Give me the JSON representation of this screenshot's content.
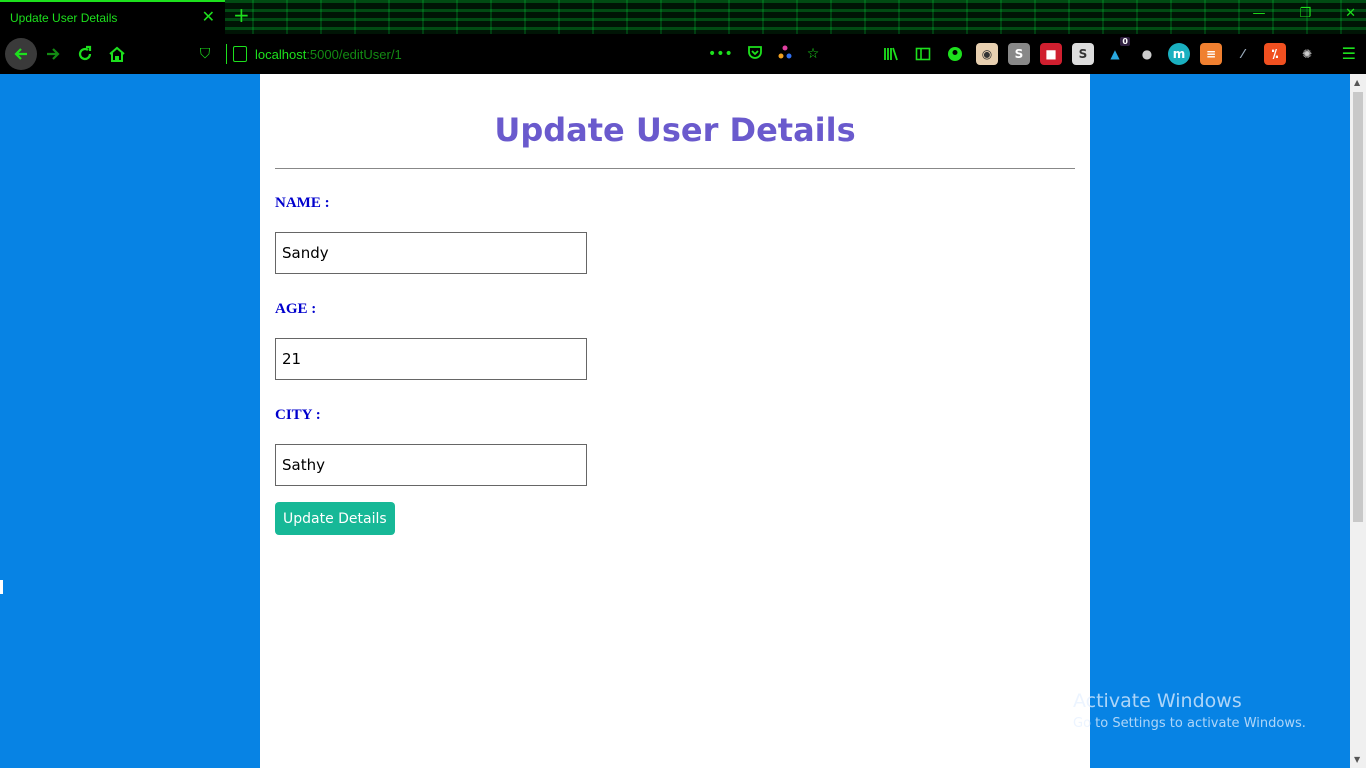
{
  "browser": {
    "tab_title": "Update User Details",
    "tab_close": "✕",
    "new_tab": "+",
    "url_host": "localhost",
    "url_path": ":5000/editUser/1",
    "notification_count": "0"
  },
  "page": {
    "title": "Update User Details",
    "fields": [
      {
        "label": "NAME :",
        "value": "Sandy"
      },
      {
        "label": "AGE :",
        "value": "21"
      },
      {
        "label": "CITY :",
        "value": "Sathy"
      }
    ],
    "submit_label": "Update Details"
  },
  "watermark": {
    "title": "Activate Windows",
    "subtitle": "Go to Settings to activate Windows."
  },
  "colors": {
    "chrome_accent": "#1de01d",
    "page_background": "#0783e4",
    "title": "#6a5acd",
    "labels": "#0000cd",
    "button": "#17b897"
  }
}
